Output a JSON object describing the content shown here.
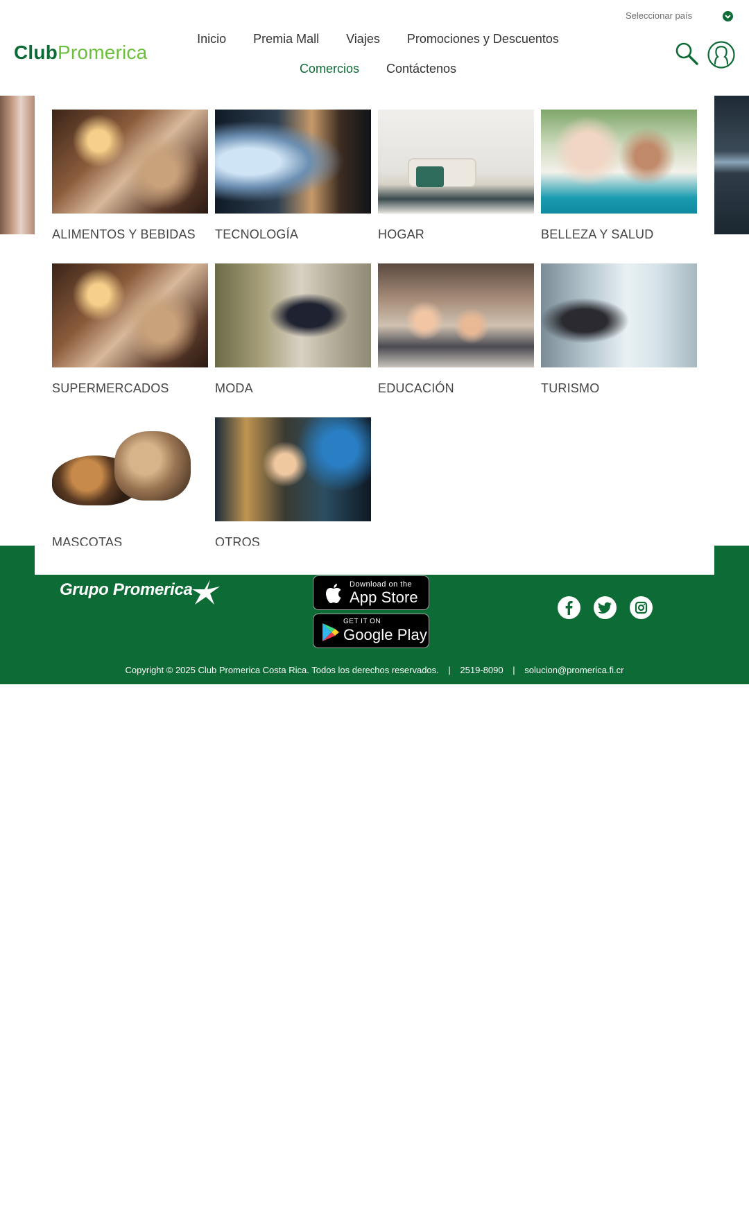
{
  "header": {
    "country_selector": "Seleccionar país",
    "logo": {
      "part1": "Club",
      "part2": "Promerica"
    },
    "nav_row1": [
      "Inicio",
      "Premia Mall",
      "Viajes",
      "Promociones y Descuentos"
    ],
    "nav_row2": [
      "Comercios",
      "Contáctenos"
    ],
    "active_item": "Comercios"
  },
  "categories": [
    {
      "label": "ALIMENTOS Y BEBIDAS",
      "image": "food-photo"
    },
    {
      "label": "TECNOLOGÍA",
      "image": "tech-photo"
    },
    {
      "label": "HOGAR",
      "image": "home-photo"
    },
    {
      "label": "BELLEZA Y SALUD",
      "image": "health-photo"
    },
    {
      "label": "SUPERMERCADOS",
      "image": "food-photo"
    },
    {
      "label": "MODA",
      "image": "fashion-photo"
    },
    {
      "label": "EDUCACIÓN",
      "image": "education-photo"
    },
    {
      "label": "TURISMO",
      "image": "travel-photo"
    },
    {
      "label": "MASCOTAS",
      "image": "pets-photo"
    },
    {
      "label": "OTROS",
      "image": "other-photo"
    }
  ],
  "footer": {
    "group_logo": "Grupo Promerica",
    "app_store": {
      "small": "Download on the",
      "big": "App Store"
    },
    "google_play": {
      "small": "GET IT ON",
      "big": "Google Play"
    },
    "social": [
      "facebook-icon",
      "twitter-icon",
      "instagram-icon"
    ],
    "copyright": "Copyright © 2025 Club Promerica Costa Rica. Todos los derechos reservados.",
    "phone": "2519-8090",
    "email": "solucion@promerica.fi.cr",
    "separator": "|"
  },
  "colors": {
    "brand_green": "#0d6b35",
    "logo_light_green": "#6abf3b"
  }
}
